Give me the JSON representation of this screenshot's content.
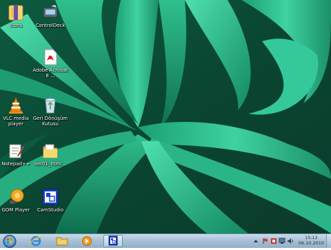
{
  "desktop": {
    "icons": [
      {
        "label": "Icons",
        "icon": "folder-icon"
      },
      {
        "label": "ControlDeck",
        "icon": "controldeck-icon"
      },
      {
        "label": "Adobe Acrobat 8 ...",
        "icon": "pdf-icon"
      },
      {
        "label": "VLC media player",
        "icon": "vlc-icon"
      },
      {
        "label": "Geri Dönüşüm Kutusu",
        "icon": "recycle-bin-icon"
      },
      {
        "label": "Notepad++",
        "icon": "notepad-icon"
      },
      {
        "label": "iler01_html...",
        "icon": "folder-icon"
      },
      {
        "label": "GOM Player",
        "icon": "gom-icon"
      },
      {
        "label": "CamStudio",
        "icon": "camstudio-icon"
      }
    ]
  },
  "taskbar": {
    "clock_time": "15:12",
    "clock_date": "06.10.2010",
    "pinned": [
      {
        "icon": "internet-explorer-icon"
      },
      {
        "icon": "explorer-folder-icon"
      },
      {
        "icon": "media-player-icon"
      },
      {
        "icon": "camstudio-icon"
      }
    ],
    "tray_icons": [
      "show-hidden-icon",
      "flag-icon",
      "security-icon",
      "network-icon",
      "volume-icon"
    ]
  },
  "colors": {
    "taskbar": "#a9c1d6",
    "wallpaper_dark": "#0b3d2c",
    "wallpaper_light": "#3fc79a"
  }
}
